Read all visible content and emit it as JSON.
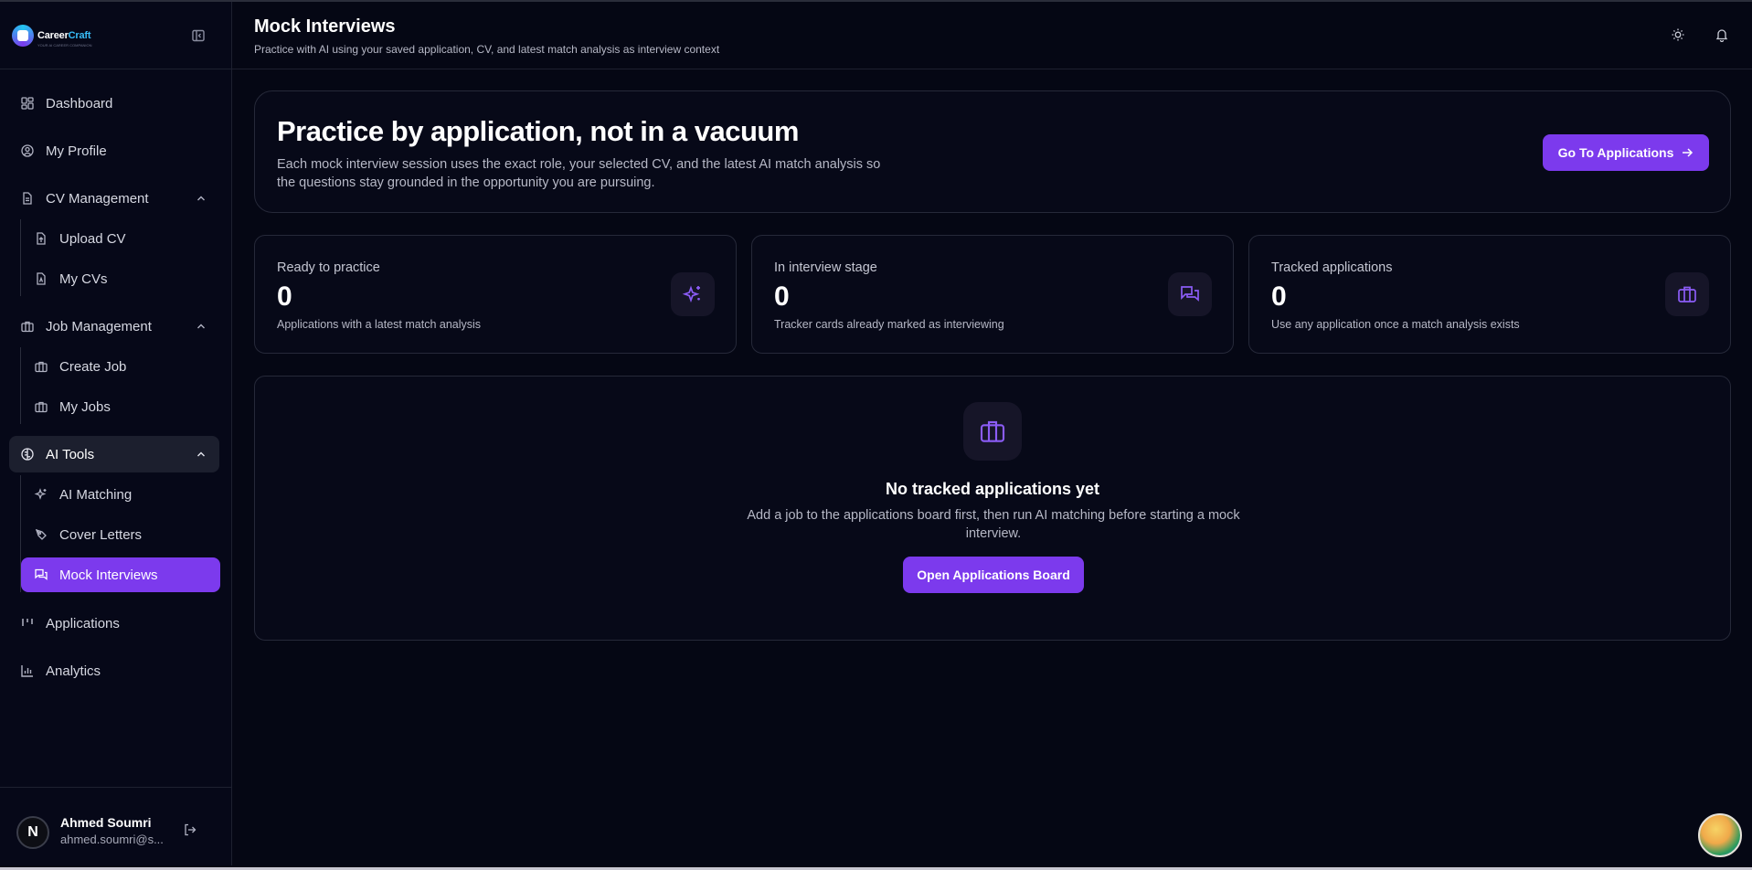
{
  "brand": {
    "name_a": "Career",
    "name_b": "Craft",
    "tagline": "YOUR AI CAREER COMPANION"
  },
  "sidebar": {
    "items": [
      {
        "label": "Dashboard",
        "icon": "dashboard-icon"
      },
      {
        "label": "My Profile",
        "icon": "user-circle-icon"
      },
      {
        "label": "CV Management",
        "icon": "file-icon",
        "expanded": true,
        "children": [
          {
            "label": "Upload CV",
            "icon": "file-upload-icon"
          },
          {
            "label": "My CVs",
            "icon": "file-text-icon"
          }
        ]
      },
      {
        "label": "Job Management",
        "icon": "briefcase-icon",
        "expanded": true,
        "children": [
          {
            "label": "Create Job",
            "icon": "briefcase-icon"
          },
          {
            "label": "My Jobs",
            "icon": "briefcase-icon"
          }
        ]
      },
      {
        "label": "AI Tools",
        "icon": "brain-icon",
        "expanded": true,
        "children": [
          {
            "label": "AI Matching",
            "icon": "sparkles-icon"
          },
          {
            "label": "Cover Letters",
            "icon": "pen-icon"
          },
          {
            "label": "Mock Interviews",
            "icon": "chat-icon",
            "active": true
          }
        ]
      },
      {
        "label": "Applications",
        "icon": "kanban-icon"
      },
      {
        "label": "Analytics",
        "icon": "bar-chart-icon"
      }
    ]
  },
  "user": {
    "name": "Ahmed Soumri",
    "email": "ahmed.soumri@s...",
    "initial": "N"
  },
  "header": {
    "title": "Mock Interviews",
    "subtitle": "Practice with AI using your saved application, CV, and latest match analysis as interview context"
  },
  "hero": {
    "title": "Practice by application, not in a vacuum",
    "description": "Each mock interview session uses the exact role, your selected CV, and the latest AI match analysis so the questions stay grounded in the opportunity you are pursuing.",
    "button": "Go To Applications"
  },
  "stats": [
    {
      "label": "Ready to practice",
      "value": "0",
      "desc": "Applications with a latest match analysis",
      "icon": "sparkles-icon"
    },
    {
      "label": "In interview stage",
      "value": "0",
      "desc": "Tracker cards already marked as interviewing",
      "icon": "chat-icon"
    },
    {
      "label": "Tracked applications",
      "value": "0",
      "desc": "Use any application once a match analysis exists",
      "icon": "briefcase-icon"
    }
  ],
  "empty_state": {
    "title": "No tracked applications yet",
    "description": "Add a job to the applications board first, then run AI matching before starting a mock interview.",
    "button": "Open Applications Board"
  },
  "colors": {
    "accent": "#7c3aed",
    "background": "#050714",
    "border": "#262939"
  }
}
